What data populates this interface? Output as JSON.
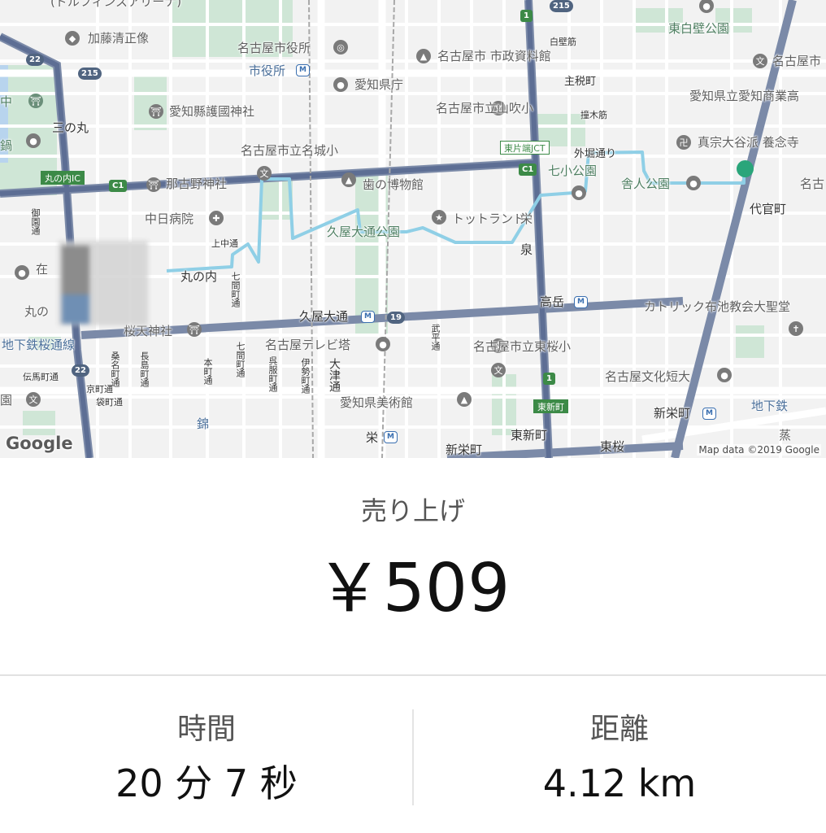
{
  "map": {
    "labels": {
      "top_partial": "(ドルフィンズアリーナ)",
      "kato": "加藤清正像",
      "city_hall": "名古屋市役所",
      "shiyakusho_station": "市役所",
      "city_archive": "名古屋市 市政資料館",
      "pref_office": "愛知県庁",
      "shirakabe": "白壁筋",
      "shumachi": "主税町",
      "higashi_shirakabe_park": "東白壁公園",
      "nagoya_koukou": "名古屋市",
      "aichi_shogyo": "愛知県立愛知商業高",
      "gokoku": "愛知縣護國神社",
      "sannomaru": "三の丸",
      "yamabuki": "名古屋市立山吹小",
      "kusunoki": "撞木筋",
      "shinshu": "真宗大谷派 養念寺",
      "nagoya_r": "名古",
      "meijo_elem": "名古屋市立名城小",
      "higashikata_jct": "東片端JCT",
      "sotobori": "外堀通り",
      "shichisho_park": "七小公園",
      "toneri_park": "舎人公園",
      "nagoya_r2": "名古",
      "marunouchi_ic": "丸の内IC",
      "nagoya_shrine": "那古野神社",
      "kaki_museum": "歯の博物館",
      "daikancho": "代官町",
      "chunichi_hospital": "中日病院",
      "totland": "トットランド",
      "sakae_r": "栄",
      "kamichoji": "上中通",
      "hisaya_park": "久屋大通公園",
      "izumi": "泉",
      "marunouchi": "丸の内",
      "zaike": "在",
      "marunouchi_partial": "丸の",
      "hisaya_station": "久屋大通",
      "takaoka_station": "高岳",
      "catholic": "カトリック布池教会大聖堂",
      "sakuratenjinja": "桜天神社",
      "subway_sakuradori": "地下鉄桜通線",
      "tv_tower": "名古屋テレビ塔",
      "higashi_sakura_elem": "名古屋市立東桜小",
      "denmacho": "伝馬町通",
      "bunka_junior": "名古屋文化短大",
      "higashi_station": "東新町",
      "art_museum": "愛知県美術館",
      "chikatetsu_r": "地下鉄",
      "shinsakae_station": "新栄町",
      "nishiki": "錦",
      "sakae_station": "栄",
      "higashishinmachi": "東新町",
      "shinsakaemachi": "新栄町",
      "tousakura": "東桜",
      "kubi": "蒸",
      "naka_left": "中",
      "tsuuba": "鍋",
      "horu": "園",
      "ryoso": "園",
      "kyomachi": "京町通",
      "tachibana": "袋町通",
      "v_gofuku": "御園通",
      "v_nagashima": "長島町通",
      "v_chojamachi": "長者町通",
      "v_honmachi": "本町通",
      "v_shichikenmachi": "七間町通",
      "v_shichikenmachi2": "七間町通",
      "v_ote": "呉服町通",
      "v_ise": "伊勢町通",
      "v_otsu": "大津通",
      "v_buhei": "武平通",
      "v_kuwana": "桑名町通",
      "v_shichiken3": "七間町通"
    },
    "shields": {
      "r1_top": "1",
      "r215_top": "215",
      "r215_left": "215",
      "r22_top": "22",
      "r22_bottom": "22",
      "c1_left": "C1",
      "c1_mid": "C1",
      "r19": "19",
      "r1_bottom": "1"
    },
    "google_logo": "Google",
    "copyright": "Map data ©2019 Google"
  },
  "summary": {
    "earnings_label": "売り上げ",
    "earnings_value": "￥509",
    "time_label": "時間",
    "time_value": "20 分 7 秒",
    "distance_label": "距離",
    "distance_value": "4.12 km"
  },
  "colors": {
    "route": "#8fcfe6",
    "destination_pin": "#2aa57a",
    "major_road": "#7b8aa8",
    "expressway": "#5d6e94"
  }
}
